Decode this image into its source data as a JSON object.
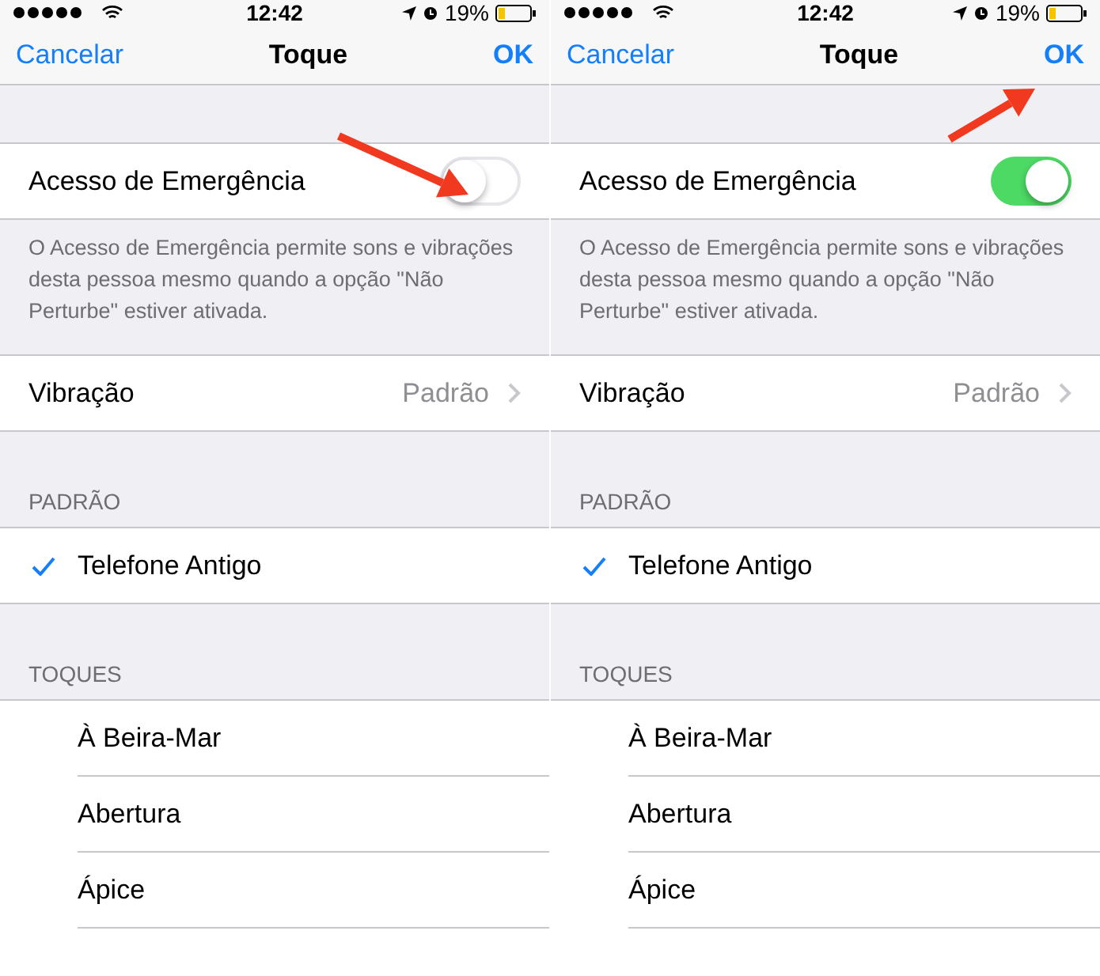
{
  "screens": [
    {
      "status": {
        "time": "12:42",
        "battery": "19%"
      },
      "nav": {
        "cancel": "Cancelar",
        "title": "Toque",
        "done": "OK"
      },
      "emergency": {
        "label": "Acesso de Emergência",
        "on": false,
        "footer": "O Acesso de Emergência permite sons e vibrações desta pessoa mesmo quando a opção \"Não Perturbe\" estiver ativada."
      },
      "vibration": {
        "label": "Vibração",
        "value": "Padrão"
      },
      "default_section": {
        "header": "PADRÃO",
        "items": [
          {
            "label": "Telefone Antigo",
            "selected": true
          }
        ]
      },
      "ringtones": {
        "header": "TOQUES",
        "items": [
          {
            "label": "À Beira-Mar",
            "selected": false
          },
          {
            "label": "Abertura",
            "selected": false
          },
          {
            "label": "Ápice",
            "selected": false
          }
        ]
      },
      "annotation": {
        "kind": "toggle"
      }
    },
    {
      "status": {
        "time": "12:42",
        "battery": "19%"
      },
      "nav": {
        "cancel": "Cancelar",
        "title": "Toque",
        "done": "OK"
      },
      "emergency": {
        "label": "Acesso de Emergência",
        "on": true,
        "footer": "O Acesso de Emergência permite sons e vibrações desta pessoa mesmo quando a opção \"Não Perturbe\" estiver ativada."
      },
      "vibration": {
        "label": "Vibração",
        "value": "Padrão"
      },
      "default_section": {
        "header": "PADRÃO",
        "items": [
          {
            "label": "Telefone Antigo",
            "selected": true
          }
        ]
      },
      "ringtones": {
        "header": "TOQUES",
        "items": [
          {
            "label": "À Beira-Mar",
            "selected": false
          },
          {
            "label": "Abertura",
            "selected": false
          },
          {
            "label": "Ápice",
            "selected": false
          }
        ]
      },
      "annotation": {
        "kind": "done"
      }
    }
  ]
}
